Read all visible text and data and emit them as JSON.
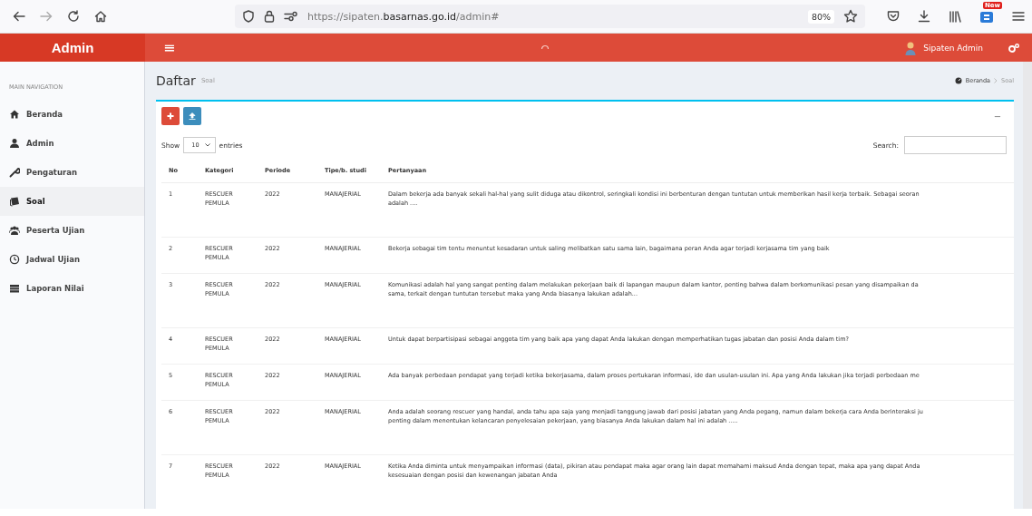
{
  "browser": {
    "url": "https://sipaten.**basarnas.go.id**/admin#",
    "zoom": "80%",
    "badge": "New"
  },
  "header": {
    "logo": "Admin",
    "menu_glyph": "≡",
    "user": "Sipaten Admin"
  },
  "sidebar": {
    "heading": "MAIN NAVIGATION",
    "items": [
      {
        "label": "Beranda",
        "kind": "home",
        "selected": false
      },
      {
        "label": "Admin",
        "kind": "user",
        "selected": false
      },
      {
        "label": "Pengaturan",
        "kind": "wrench",
        "selected": false
      },
      {
        "label": "Soal",
        "kind": "book",
        "selected": true
      },
      {
        "label": "Peserta Ujian",
        "kind": "users",
        "selected": false
      },
      {
        "label": "Jadwal Ujian",
        "kind": "clock",
        "selected": false
      },
      {
        "label": "Laporan Nilai",
        "kind": "table",
        "selected": false
      }
    ]
  },
  "page": {
    "title": "Daftar",
    "subtitle": "Soal",
    "breadcrumb": [
      "Beranda",
      "Soal"
    ],
    "collapse_glyph": "−"
  },
  "toolbar": [
    {
      "kind": "add"
    },
    {
      "kind": "upload"
    }
  ],
  "table_controls": {
    "show_label": "Show",
    "page_size": "10",
    "entries_label": "entries",
    "search_label": "Search:"
  },
  "table": {
    "columns": [
      "No",
      "Kategori",
      "Periode",
      "Tipe/b. studi",
      "Pertanyaan"
    ],
    "rows": [
      {
        "no": "1",
        "kategori": "RESCUER PEMULA",
        "periode": "2022",
        "tipe": "MANAJERIAL",
        "pertanyaan": [
          "Dalam bekerja ada banyak sekali hal-hal yang sulit diduga atau dikontrol, seringkali kondisi ini berbenturan dengan tuntutan untuk memberikan hasil kerja terbaik. Sebagai seoran",
          "adalah ...."
        ]
      },
      {
        "no": "2",
        "kategori": "RESCUER PEMULA",
        "periode": "2022",
        "tipe": "MANAJERIAL",
        "pertanyaan": [
          "Bekerja sebagai tim tentu menuntut kesadaran untuk saling melibatkan satu sama lain, bagaimana peran Anda agar terjadi kerjasama tim yang baik"
        ]
      },
      {
        "no": "3",
        "kategori": "RESCUER PEMULA",
        "periode": "2022",
        "tipe": "MANAJERIAL",
        "pertanyaan": [
          "Komunikasi adalah hal yang sangat penting dalam melakukan pekerjaan baik di lapangan maupun dalam kantor, penting bahwa dalam berkomunikasi pesan yang disampaikan da",
          "sama, terkait dengan tuntutan tersebut maka yang Anda biasanya lakukan adalah..."
        ]
      },
      {
        "no": "4",
        "kategori": "RESCUER PEMULA",
        "periode": "2022",
        "tipe": "MANAJERIAL",
        "pertanyaan": [
          "Untuk dapat berpartisipasi sebagai anggota tim yang baik apa yang dapat Anda lakukan dengan memperhatikan tugas jabatan dan posisi Anda dalam tim?"
        ]
      },
      {
        "no": "5",
        "kategori": "RESCUER PEMULA",
        "periode": "2022",
        "tipe": "MANAJERIAL",
        "pertanyaan": [
          "Ada banyak perbedaan pendapat yang terjadi ketika bekerjasama, dalam proses pertukaran informasi, ide dan usulan-usulan ini. Apa yang Anda lakukan jika terjadi perbedaan me"
        ]
      },
      {
        "no": "6",
        "kategori": "RESCUER PEMULA",
        "periode": "2022",
        "tipe": "MANAJERIAL",
        "pertanyaan": [
          "Anda adalah seorang rescuer yang handal, anda tahu apa saja yang menjadi tanggung jawab dari posisi jabatan yang Anda pegang, namun dalam bekerja cara Anda berinteraksi ju",
          "penting dalam menentukan kelancaran penyelesaian pekerjaan, yang biasanya Anda lakukan dalam hal ini adalah ....."
        ]
      },
      {
        "no": "7",
        "kategori": "RESCUER PEMULA",
        "periode": "2022",
        "tipe": "MANAJERIAL",
        "pertanyaan": [
          "Ketika Anda diminta untuk menyampaikan informasi (data), pikiran atau pendapat maka agar orang lain dapat memahami maksud Anda dengan tepat, maka apa yang dapat Anda",
          "kesesuaian dengan posisi dan kewenangan jabatan Anda"
        ]
      }
    ]
  }
}
